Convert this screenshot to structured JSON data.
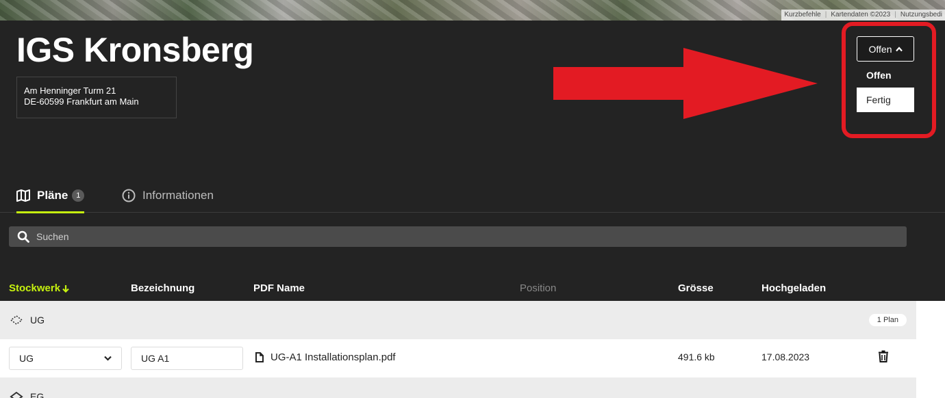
{
  "map": {
    "attribution": [
      "Kurzbefehle",
      "Kartendaten ©2023",
      "Nutzungsbedi"
    ]
  },
  "header": {
    "title": "IGS Kronsberg",
    "address_line1": "Am Henninger Turm 21",
    "address_line2": "DE-60599 Frankfurt am Main"
  },
  "status": {
    "selected": "Offen",
    "options": [
      "Offen",
      "Fertig"
    ],
    "highlight_color": "#e31b23"
  },
  "tabs": [
    {
      "label": "Pläne",
      "badge": "1",
      "icon": "map-icon",
      "active": true
    },
    {
      "label": "Informationen",
      "icon": "info-icon",
      "active": false
    }
  ],
  "search": {
    "placeholder": "Suchen"
  },
  "table": {
    "columns": [
      "Stockwerk",
      "Bezeichnung",
      "PDF Name",
      "Position",
      "Grösse",
      "Hochgeladen"
    ],
    "groups": [
      {
        "floor": "UG",
        "count_label": "1 Plan",
        "rows": [
          {
            "floor": "UG",
            "name": "UG A1",
            "pdf": "UG-A1 Installationsplan.pdf",
            "size": "491.6 kb",
            "uploaded": "17.08.2023"
          }
        ]
      },
      {
        "floor": "EG",
        "count_label": "",
        "rows": []
      }
    ]
  },
  "colors": {
    "accent": "#c6f10f",
    "background": "#232323"
  }
}
